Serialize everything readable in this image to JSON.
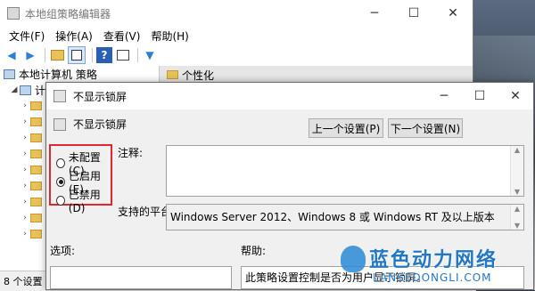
{
  "main_window": {
    "title": "本地组策略编辑器",
    "controls": {
      "minimize": "─",
      "maximize": "☐",
      "close": "✕"
    },
    "menu": [
      "文件(F)",
      "操作(A)",
      "查看(V)",
      "帮助(H)"
    ],
    "toolbar_icons": [
      "back-arrow-icon",
      "forward-arrow-icon",
      "folder-up-icon",
      "show-hide-tree-icon",
      "help-icon",
      "properties-icon",
      "filter-icon"
    ],
    "tree": [
      {
        "label": "本地计算机 策略",
        "expanded": true,
        "icon": "computer-icon"
      },
      {
        "label": "计算机配置",
        "expanded": true,
        "icon": "computer-icon"
      },
      {
        "label": "",
        "expanded": false,
        "icon": "folder-icon"
      },
      {
        "label": "",
        "expanded": false,
        "icon": "folder-icon"
      },
      {
        "label": "",
        "expanded": false,
        "icon": "folder-icon"
      },
      {
        "label": "",
        "expanded": false,
        "icon": "folder-icon"
      },
      {
        "label": "",
        "expanded": false,
        "icon": "folder-icon"
      },
      {
        "label": "",
        "expanded": false,
        "icon": "folder-icon"
      },
      {
        "label": "",
        "expanded": false,
        "icon": "folder-icon"
      },
      {
        "label": "",
        "expanded": false,
        "icon": "folder-icon"
      },
      {
        "label": "",
        "expanded": false,
        "icon": "folder-icon"
      }
    ],
    "right_header": "个性化",
    "status": "8 个设置"
  },
  "dialog": {
    "title": "不显示锁屏",
    "controls": {
      "minimize": "─",
      "maximize": "☐",
      "close": "✕"
    },
    "setting_name": "不显示锁屏",
    "prev_button": "上一个设置(P)",
    "next_button": "下一个设置(N)",
    "options": [
      {
        "label": "未配置(C)",
        "checked": false
      },
      {
        "label": "已启用(E)",
        "checked": true
      },
      {
        "label": "已禁用(D)",
        "checked": false
      }
    ],
    "comment_label": "注释:",
    "platform_label": "支持的平台:",
    "platform_value": "Windows Server 2012、Windows 8 或 Windows RT 及以上版本",
    "options_label": "选项:",
    "help_label": "帮助:",
    "help_text": "此策略设置控制是否为用户显示锁屏。"
  },
  "watermark": {
    "cn": "蓝色动力网络",
    "en": "LANSEDONGLI.COM"
  },
  "colors": {
    "highlight_box": "#e0262e",
    "accent": "#2377c4"
  }
}
